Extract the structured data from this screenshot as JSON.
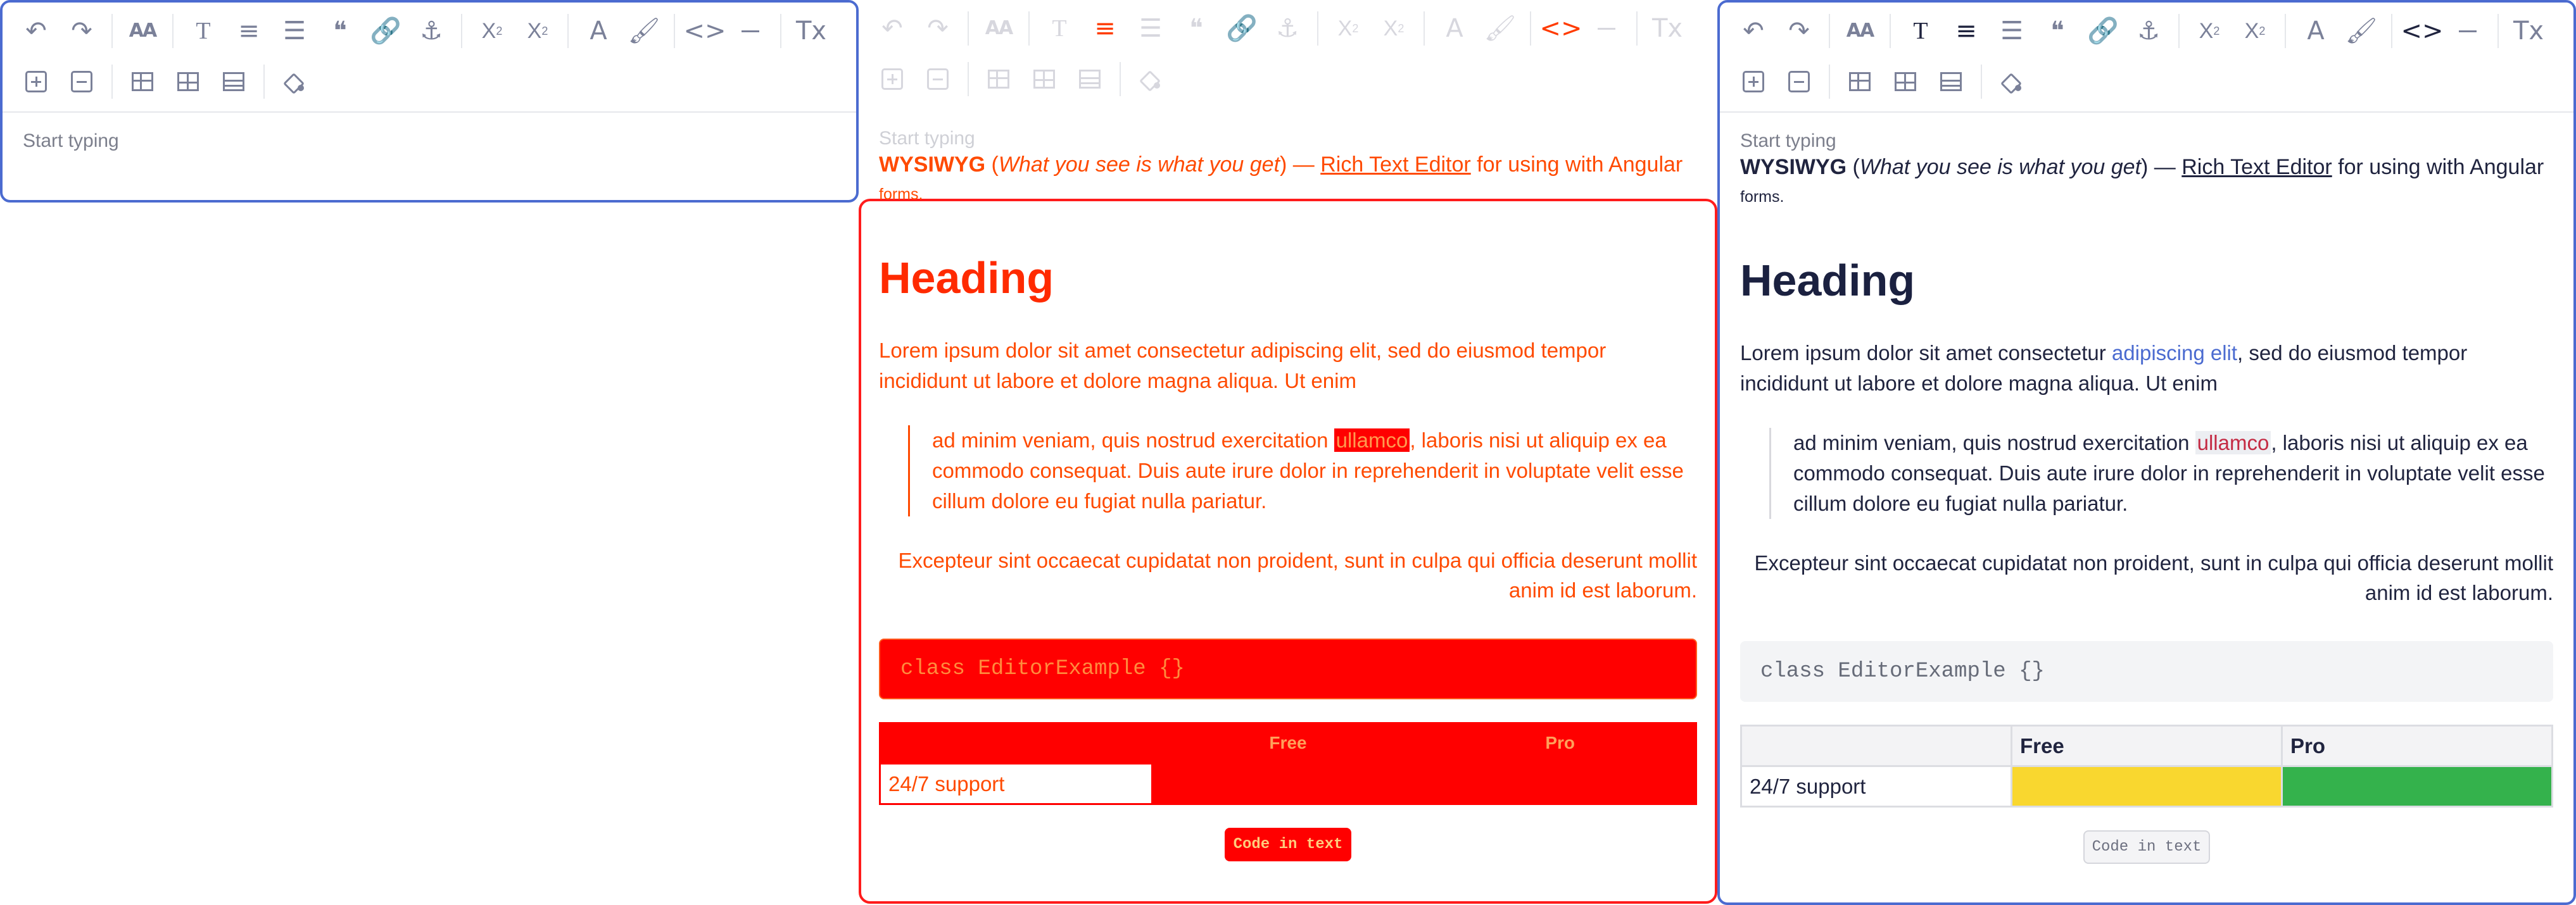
{
  "panels": {
    "left": {
      "placeholder": "Start typing"
    },
    "middle": {
      "placeholder": "Start typing",
      "intro_bold": "WYSIWYG",
      "intro_italic": "What you see is what you get",
      "intro_dash": "—",
      "intro_link": "Rich Text Editor",
      "intro_rest": "for using with Angular",
      "intro_small": "forms.",
      "heading": "Heading",
      "paragraph_start": "Lorem ipsum dolor sit amet consectetur",
      "paragraph_highlight": "adipiscing elit",
      "paragraph_end": ", sed do eiusmod tempor incididunt ut labore et dolore magna aliqua. Ut enim",
      "quote_start": "ad minim veniam, quis nostrud exercitation",
      "quote_highlight": "ullamco",
      "quote_end": ", laboris nisi ut aliquip ex ea commodo consequat. Duis aute irure dolor in reprehenderit in voluptate velit esse cillum dolore eu fugiat nulla pariatur.",
      "right_paragraph": "Excepteur sint occaecat cupidatat non proident, sunt in culpa qui officia deserunt mollit anim id est laborum.",
      "code_block": "class EditorExample {}",
      "table": {
        "headers": [
          "",
          "Free",
          "Pro"
        ],
        "row_label": "24/7 support"
      },
      "inline_code": "Code in text"
    },
    "right": {
      "placeholder": "Start typing",
      "intro_bold": "WYSIWYG",
      "intro_italic": "What you see is what you get",
      "intro_dash": "—",
      "intro_link": "Rich Text Editor",
      "intro_rest": "for using with Angular",
      "intro_small": "forms.",
      "heading": "Heading",
      "paragraph_start": "Lorem ipsum dolor sit amet consectetur",
      "paragraph_highlight": "adipiscing elit",
      "paragraph_end": ", sed do eiusmod tempor incididunt ut labore et dolore magna aliqua. Ut enim",
      "quote_start": "ad minim veniam, quis nostrud exercitation",
      "quote_highlight": "ullamco",
      "quote_end": ", laboris nisi ut aliquip ex ea commodo consequat. Duis aute irure dolor in reprehenderit in voluptate velit esse cillum dolore eu fugiat nulla pariatur.",
      "right_paragraph": "Excepteur sint occaecat cupidatat non proident, sunt in culpa qui officia deserunt mollit anim id est laborum.",
      "code_block": "class EditorExample {}",
      "table": {
        "headers": [
          "",
          "Free",
          "Pro"
        ],
        "row_label": "24/7 support"
      },
      "inline_code": "Code in text"
    }
  },
  "colors": {
    "blue_border": "#4b6bd0",
    "red_border": "#ff1c1c",
    "yellow_cell": "#f9d72f",
    "green_cell": "#34b24c"
  },
  "icons": {
    "toolbar_row_1": [
      "undo-icon",
      "redo-icon",
      "font-size-icon",
      "text-style-icon",
      "align-icon",
      "list-icon",
      "quote-icon",
      "link-icon",
      "anchor-icon",
      "subscript-icon",
      "superscript-icon",
      "text-color-icon",
      "paint-format-icon",
      "code-icon",
      "horizontal-rule-icon",
      "clear-format-icon"
    ],
    "toolbar_row_2": [
      "add-block-icon",
      "remove-block-icon",
      "table-icon",
      "insert-column-icon",
      "table-rows-icon",
      "fill-color-icon"
    ]
  }
}
